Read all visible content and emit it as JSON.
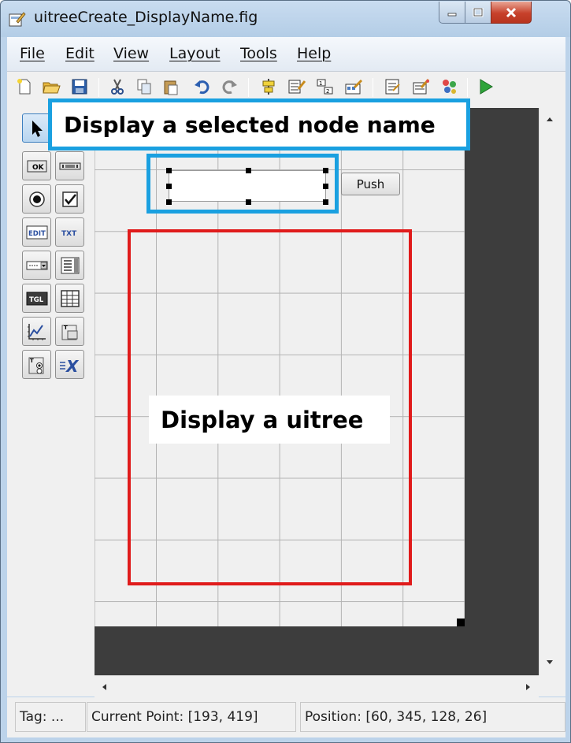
{
  "window": {
    "title": "uitreeCreate_DisplayName.fig"
  },
  "menu": {
    "items": [
      "File",
      "Edit",
      "View",
      "Layout",
      "Tools",
      "Help"
    ]
  },
  "toolbar": {
    "icons": [
      "new-file-icon",
      "open-folder-icon",
      "save-icon",
      "cut-icon",
      "copy-icon",
      "paste-icon",
      "undo-icon",
      "redo-icon",
      "align-icon",
      "menu-editor-icon",
      "tab-order-icon",
      "toolbar-editor-icon",
      "mfile-editor-icon",
      "property-inspector-icon",
      "object-browser-icon",
      "run-icon"
    ]
  },
  "palette": {
    "tools": [
      "Select",
      "OK",
      "Slider",
      "Radio",
      "Check",
      "EDIT",
      "TXT",
      "Popup",
      "Listbox",
      "TGL",
      "Table",
      "Axes",
      "Panel",
      "ButtonGroup",
      "ActiveX"
    ],
    "labels": {
      "ok": "OK",
      "edit": "EDIT",
      "txt": "TXT",
      "tgl": "TGL"
    }
  },
  "figure": {
    "push_button_label": "Push"
  },
  "annotations": {
    "top_label": "Display a selected node name",
    "tree_label": "Display a uitree",
    "colors": {
      "blue": "#1aa0e0",
      "red": "#e01b1b"
    }
  },
  "status": {
    "tag": "Tag: ...",
    "current_point": "Current Point:  [193, 419]",
    "position": "Position: [60, 345, 128, 26]"
  }
}
